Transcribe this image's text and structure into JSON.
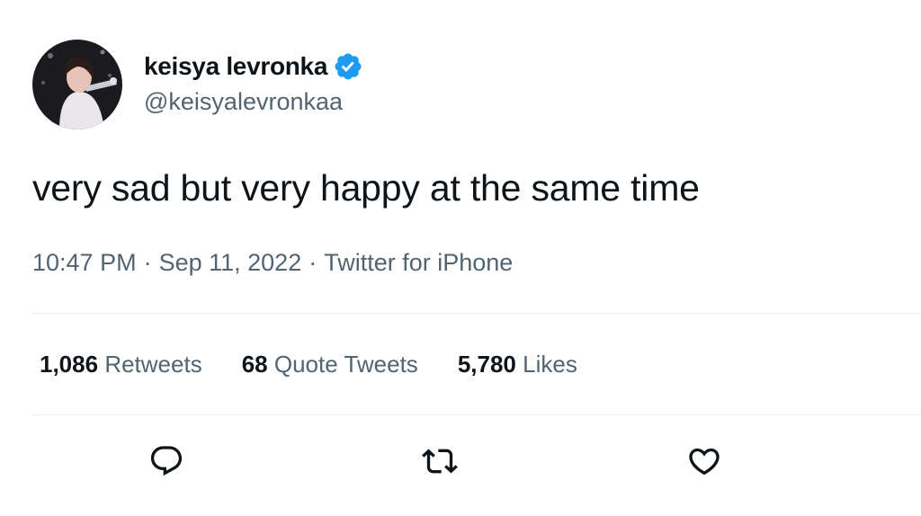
{
  "tweet": {
    "author": {
      "display_name": "keisya levronka",
      "handle": "@keisyalevronkaa",
      "verified": true
    },
    "text": "very sad but very happy at the same time",
    "meta": {
      "time": "10:47 PM",
      "date": "Sep 11, 2022",
      "source": "Twitter for iPhone",
      "separator": "·"
    },
    "stats": [
      {
        "count": "1,086",
        "label": "Retweets"
      },
      {
        "count": "68",
        "label": "Quote Tweets"
      },
      {
        "count": "5,780",
        "label": "Likes"
      }
    ],
    "actions": [
      {
        "icon": "reply-icon"
      },
      {
        "icon": "retweet-icon"
      },
      {
        "icon": "like-icon"
      }
    ]
  },
  "colors": {
    "verified": "#1d9bf0",
    "primary_text": "#0f1419",
    "secondary_text": "#536471",
    "divider": "#e6ecf0"
  }
}
